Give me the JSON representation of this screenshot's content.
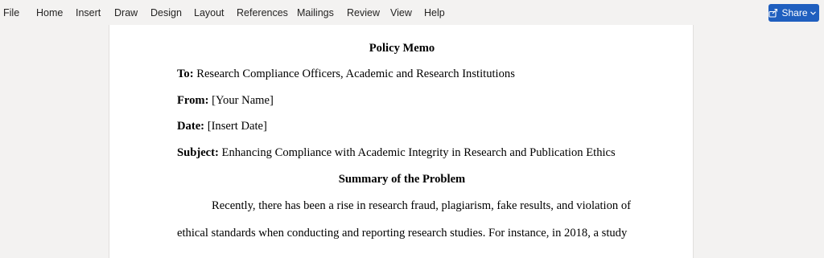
{
  "ribbon": {
    "tabs": [
      "File",
      "Home",
      "Insert",
      "Draw",
      "Design",
      "Layout",
      "References",
      "Mailings",
      "Review",
      "View",
      "Help"
    ],
    "share_label": "Share"
  },
  "document": {
    "title": "Policy Memo",
    "to_label": "To:",
    "to_value": "Research Compliance Officers, Academic and Research Institutions",
    "from_label": "From:",
    "from_value": "[Your Name]",
    "date_label": "Date:",
    "date_value": "[Insert Date]",
    "subject_label": "Subject:",
    "subject_value": "Enhancing Compliance with Academic Integrity in Research and Publication Ethics",
    "section_heading": "Summary of the Problem",
    "paragraph_line_1": "Recently, there has been a rise in research fraud, plagiarism, fake results, and violation of",
    "paragraph_line_2": "ethical standards when conducting and reporting research studies. For instance, in 2018, a study"
  }
}
